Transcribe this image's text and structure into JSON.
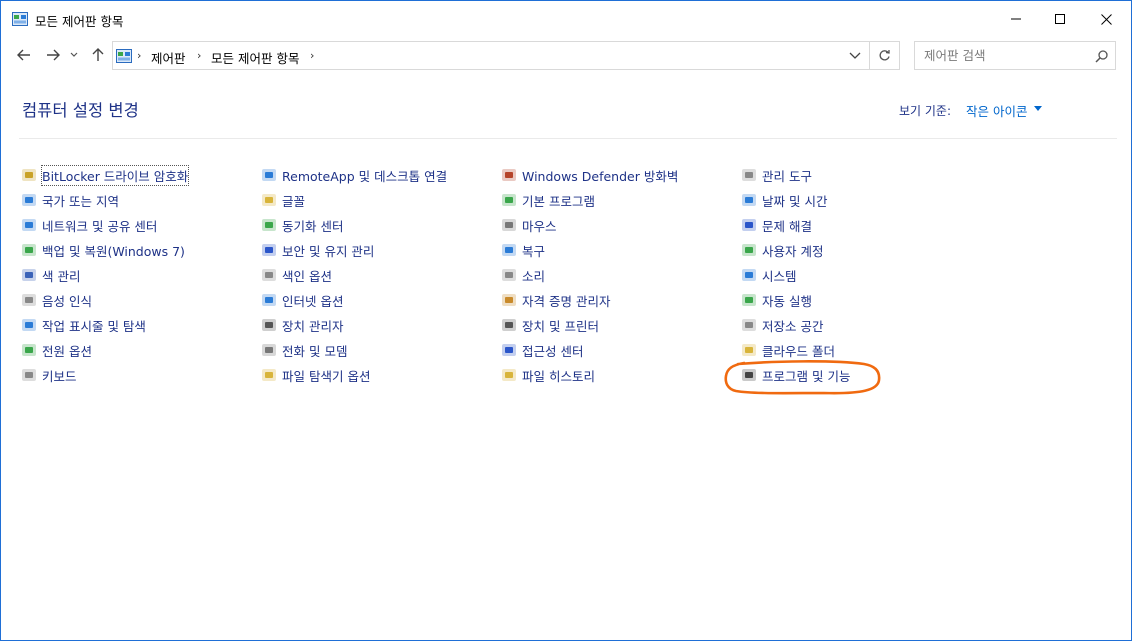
{
  "window": {
    "title": "모든 제어판 항목"
  },
  "address": {
    "crumbs": [
      "제어판",
      "모든 제어판 항목"
    ]
  },
  "search": {
    "placeholder": "제어판 검색"
  },
  "header": {
    "title": "컴퓨터 설정 변경",
    "view_by_label": "보기 기준:",
    "view_by_value": "작은 아이콘"
  },
  "columns": [
    [
      {
        "label": "BitLocker 드라이브 암호화",
        "icon": "bitlocker-icon",
        "color": "#c9a227"
      },
      {
        "label": "국가 또는 지역",
        "icon": "globe-icon",
        "color": "#2a7bd6"
      },
      {
        "label": "네트워크 및 공유 센터",
        "icon": "network-icon",
        "color": "#2a7bd6"
      },
      {
        "label": "백업 및 복원(Windows 7)",
        "icon": "backup-icon",
        "color": "#3aa64a"
      },
      {
        "label": "색 관리",
        "icon": "color-management-icon",
        "color": "#3a62b8"
      },
      {
        "label": "음성 인식",
        "icon": "microphone-icon",
        "color": "#888888"
      },
      {
        "label": "작업 표시줄 및 탐색",
        "icon": "taskbar-icon",
        "color": "#2a7bd6"
      },
      {
        "label": "전원 옵션",
        "icon": "power-icon",
        "color": "#3aa64a"
      },
      {
        "label": "키보드",
        "icon": "keyboard-icon",
        "color": "#888888"
      }
    ],
    [
      {
        "label": "RemoteApp 및 데스크톱 연결",
        "icon": "remoteapp-icon",
        "color": "#2a7bd6"
      },
      {
        "label": "글꼴",
        "icon": "font-icon",
        "color": "#d8b43a"
      },
      {
        "label": "동기화 센터",
        "icon": "sync-icon",
        "color": "#3aa64a"
      },
      {
        "label": "보안 및 유지 관리",
        "icon": "flag-icon",
        "color": "#2a55c9"
      },
      {
        "label": "색인 옵션",
        "icon": "indexing-icon",
        "color": "#888888"
      },
      {
        "label": "인터넷 옵션",
        "icon": "internet-icon",
        "color": "#2a7bd6"
      },
      {
        "label": "장치 관리자",
        "icon": "device-manager-icon",
        "color": "#555555"
      },
      {
        "label": "전화 및 모뎀",
        "icon": "phone-icon",
        "color": "#777777"
      },
      {
        "label": "파일 탐색기 옵션",
        "icon": "folder-options-icon",
        "color": "#d8b43a"
      }
    ],
    [
      {
        "label": "Windows Defender 방화벽",
        "icon": "firewall-icon",
        "color": "#b5442a"
      },
      {
        "label": "기본 프로그램",
        "icon": "default-programs-icon",
        "color": "#3aa64a"
      },
      {
        "label": "마우스",
        "icon": "mouse-icon",
        "color": "#777777"
      },
      {
        "label": "복구",
        "icon": "recovery-icon",
        "color": "#2a7bd6"
      },
      {
        "label": "소리",
        "icon": "speaker-icon",
        "color": "#888888"
      },
      {
        "label": "자격 증명 관리자",
        "icon": "credential-icon",
        "color": "#c98a2a"
      },
      {
        "label": "장치 및 프린터",
        "icon": "printer-icon",
        "color": "#555555"
      },
      {
        "label": "접근성 센터",
        "icon": "accessibility-icon",
        "color": "#2a55c9"
      },
      {
        "label": "파일 히스토리",
        "icon": "file-history-icon",
        "color": "#d8b43a"
      }
    ],
    [
      {
        "label": "관리 도구",
        "icon": "admin-tools-icon",
        "color": "#888888"
      },
      {
        "label": "날짜 및 시간",
        "icon": "clock-icon",
        "color": "#2a7bd6"
      },
      {
        "label": "문제 해결",
        "icon": "troubleshoot-icon",
        "color": "#2a55c9"
      },
      {
        "label": "사용자 계정",
        "icon": "users-icon",
        "color": "#3aa64a"
      },
      {
        "label": "시스템",
        "icon": "system-icon",
        "color": "#2a7bd6"
      },
      {
        "label": "자동 실행",
        "icon": "autoplay-icon",
        "color": "#3aa64a"
      },
      {
        "label": "저장소 공간",
        "icon": "storage-icon",
        "color": "#888888"
      },
      {
        "label": "클라우드 폴더",
        "icon": "work-folders-icon",
        "color": "#d8b43a"
      },
      {
        "label": "프로그램 및 기능",
        "icon": "programs-features-icon",
        "color": "#444444"
      }
    ]
  ],
  "colors": {
    "link": "#1e3287",
    "accent": "#0066cc",
    "highlight": "#f06a10"
  }
}
